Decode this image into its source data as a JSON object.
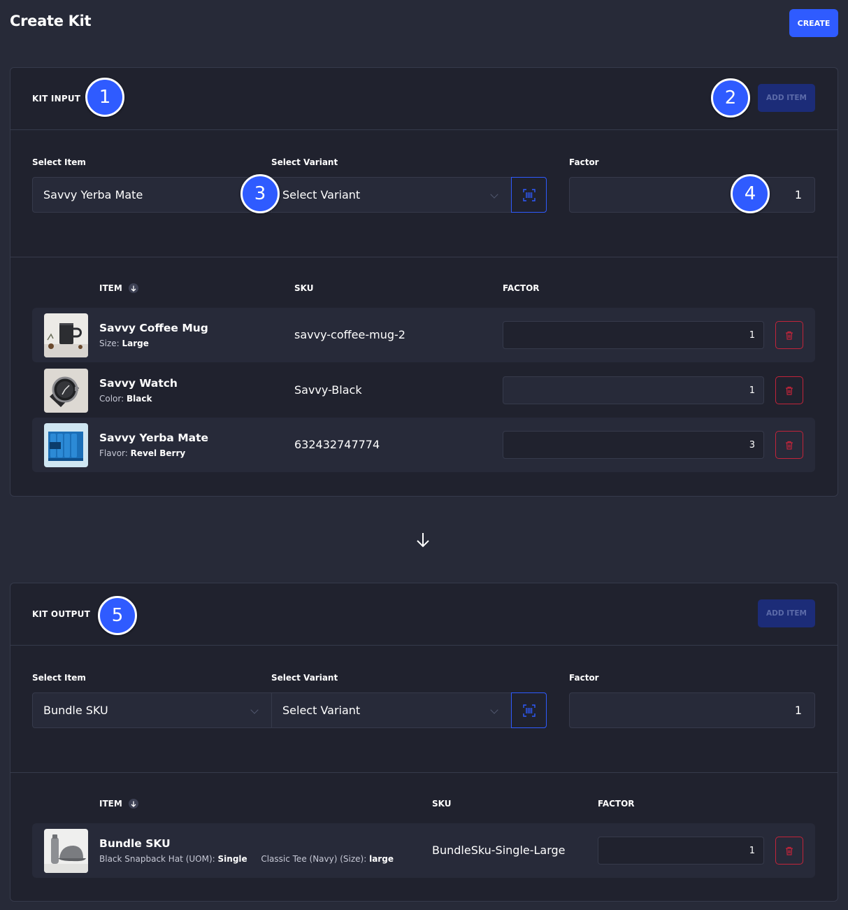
{
  "page": {
    "title": "Create Kit",
    "create_label": "CREATE"
  },
  "kit_input": {
    "title": "KIT INPUT",
    "add_item_label": "ADD ITEM",
    "select_item_label": "Select Item",
    "select_item_value": "Savvy Yerba Mate",
    "select_variant_label": "Select Variant",
    "select_variant_value": "Select Variant",
    "factor_label": "Factor",
    "factor_value": "1",
    "columns": {
      "item": "ITEM",
      "sku": "SKU",
      "factor": "FACTOR"
    },
    "rows": [
      {
        "name": "Savvy Coffee Mug",
        "attr_label": "Size:",
        "attr_value": "Large",
        "sku": "savvy-coffee-mug-2",
        "factor": "1",
        "image": "coffee-mug-image"
      },
      {
        "name": "Savvy Watch",
        "attr_label": "Color:",
        "attr_value": "Black",
        "sku": "Savvy-Black",
        "factor": "1",
        "image": "watch-image"
      },
      {
        "name": "Savvy Yerba Mate",
        "attr_label": "Flavor:",
        "attr_value": "Revel Berry",
        "sku": "632432747774",
        "factor": "3",
        "image": "yerba-mate-image"
      }
    ]
  },
  "kit_output": {
    "title": "KIT OUTPUT",
    "add_item_label": "ADD ITEM",
    "select_item_label": "Select Item",
    "select_item_value": "Bundle SKU",
    "select_variant_label": "Select Variant",
    "select_variant_value": "Select Variant",
    "factor_label": "Factor",
    "factor_value": "1",
    "columns": {
      "item": "ITEM",
      "sku": "SKU",
      "factor": "FACTOR"
    },
    "rows": [
      {
        "name": "Bundle SKU",
        "attr1_label": "Black Snapback Hat (UOM):",
        "attr1_value": "Single",
        "attr2_label": "Classic Tee (Navy) (Size):",
        "attr2_value": "large",
        "sku": "BundleSku-Single-Large",
        "factor": "1",
        "image": "bundle-image"
      }
    ]
  },
  "badges": [
    "1",
    "2",
    "3",
    "4",
    "5"
  ],
  "colors": {
    "background": "#272a38",
    "card": "#20222e",
    "accent": "#2f5bff",
    "danger": "#c3243a",
    "disabled_button": "#1c2c78"
  },
  "icons": [
    "arrow-down-icon",
    "barcode-scan-icon",
    "trash-icon",
    "chevron-down-icon",
    "sort-down-icon"
  ]
}
